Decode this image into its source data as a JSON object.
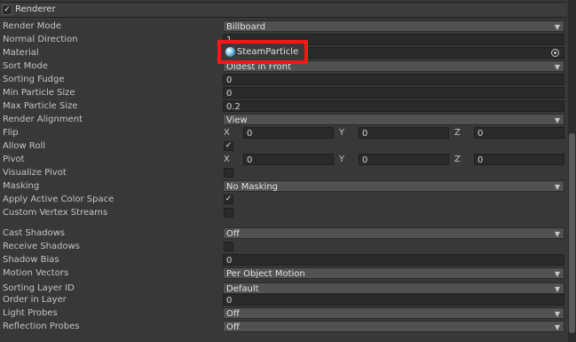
{
  "section": {
    "title": "Renderer",
    "enabled_mark": "✓"
  },
  "checkmark": "✓",
  "rows": {
    "render_mode": {
      "label": "Render Mode",
      "value": "Billboard"
    },
    "normal_direction": {
      "label": "Normal Direction",
      "value": "1"
    },
    "material": {
      "label": "Material",
      "value": "SteamParticle"
    },
    "sort_mode": {
      "label": "Sort Mode",
      "value": "Oldest in Front"
    },
    "sorting_fudge": {
      "label": "Sorting Fudge",
      "value": "0"
    },
    "min_particle_size": {
      "label": "Min Particle Size",
      "value": "0"
    },
    "max_particle_size": {
      "label": "Max Particle Size",
      "value": "0.2"
    },
    "render_alignment": {
      "label": "Render Alignment",
      "value": "View"
    },
    "flip": {
      "label": "Flip",
      "x_label": "X",
      "x": "0",
      "y_label": "Y",
      "y": "0",
      "z_label": "Z",
      "z": "0"
    },
    "allow_roll": {
      "label": "Allow Roll",
      "checked": true
    },
    "pivot": {
      "label": "Pivot",
      "x_label": "X",
      "x": "0",
      "y_label": "Y",
      "y": "0",
      "z_label": "Z",
      "z": "0"
    },
    "visualize_pivot": {
      "label": "Visualize Pivot",
      "checked": false
    },
    "masking": {
      "label": "Masking",
      "value": "No Masking"
    },
    "apply_active_color_space": {
      "label": "Apply Active Color Space",
      "checked": true
    },
    "custom_vertex_streams": {
      "label": "Custom Vertex Streams",
      "checked": false
    },
    "cast_shadows": {
      "label": "Cast Shadows",
      "value": "Off"
    },
    "receive_shadows": {
      "label": "Receive Shadows",
      "checked": false
    },
    "shadow_bias": {
      "label": "Shadow Bias",
      "value": "0"
    },
    "motion_vectors": {
      "label": "Motion Vectors",
      "value": "Per Object Motion"
    },
    "sorting_layer_id": {
      "label": "Sorting Layer ID",
      "value": "Default"
    },
    "order_in_layer": {
      "label": "Order in Layer",
      "value": "0"
    },
    "light_probes": {
      "label": "Light Probes",
      "value": "Off"
    },
    "reflection_probes": {
      "label": "Reflection Probes",
      "value": "Off"
    }
  },
  "icons": {
    "dropdown": "chevron-down-icon",
    "object_picker": "object-picker-icon",
    "material": "material-sphere-icon"
  },
  "colors": {
    "highlight": "#ff1515",
    "background": "#383838",
    "field": "#2a2a2a",
    "dropdown": "#515151"
  }
}
